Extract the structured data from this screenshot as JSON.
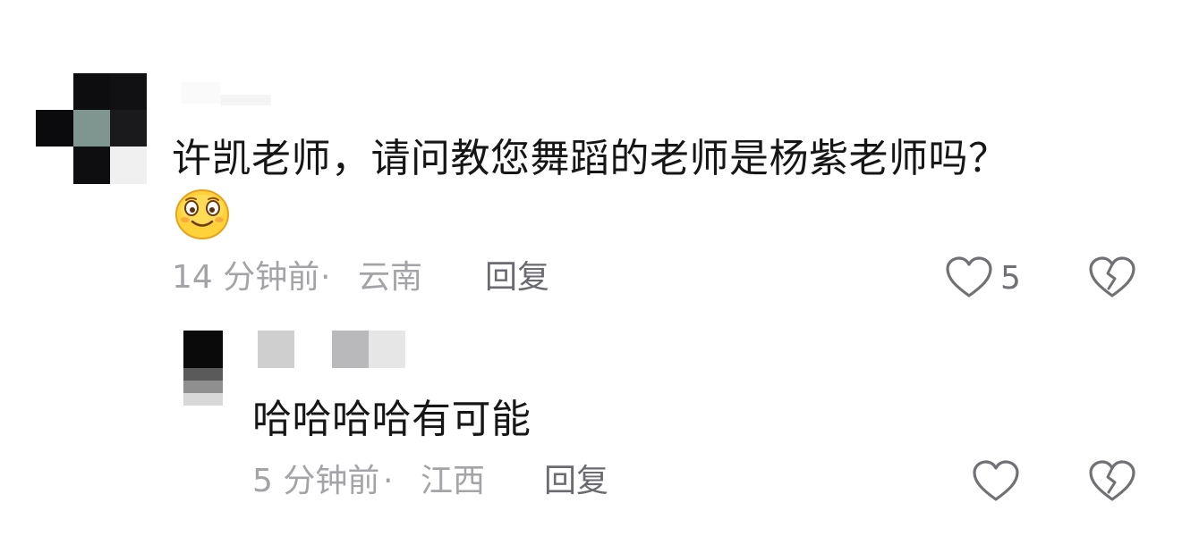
{
  "colors": {
    "text_primary": "#161616",
    "text_meta": "#a3a3a8",
    "reply_link": "#6a6a70",
    "icon_stroke": "#707075",
    "emoji_face": "#ffd23a"
  },
  "comment": {
    "text": "许凯老师，请问教您舞蹈的老师是杨紫老师吗？",
    "emoji": "smiling-face-emoji",
    "time": "14 分钟前",
    "separator": "·",
    "location": "云南",
    "reply_label": "回复",
    "like_count": "5",
    "like_icon": "heart-outline-icon",
    "dislike_icon": "broken-heart-icon"
  },
  "reply": {
    "text": "哈哈哈哈有可能",
    "time": "5 分钟前",
    "separator": "·",
    "location": "江西",
    "reply_label": "回复",
    "like_icon": "heart-outline-icon",
    "dislike_icon": "broken-heart-icon"
  }
}
